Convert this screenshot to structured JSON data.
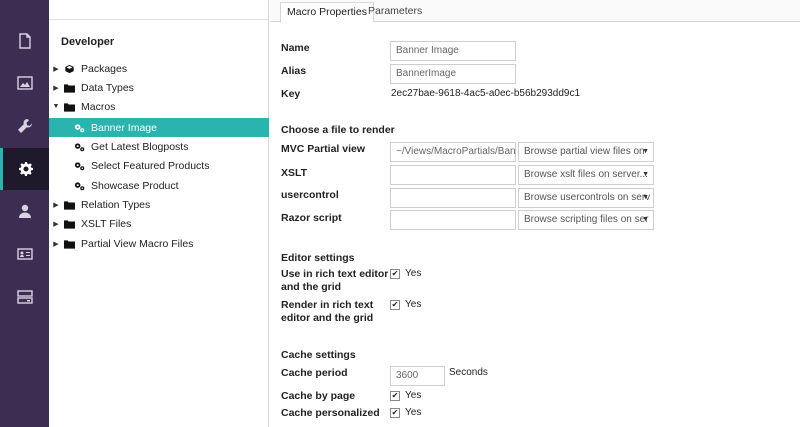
{
  "tabs": [
    {
      "label": "Macro Properties"
    },
    {
      "label": "Parameters"
    }
  ],
  "tree": {
    "section": "Developer",
    "nodes": [
      {
        "label": "Packages",
        "icon": "box-icon"
      },
      {
        "label": "Data Types",
        "icon": "folder-icon"
      },
      {
        "label": "Macros",
        "icon": "folder-icon"
      },
      {
        "label": "Banner Image",
        "icon": "cogs-icon"
      },
      {
        "label": "Get Latest Blogposts",
        "icon": "cogs-icon"
      },
      {
        "label": "Select Featured Products",
        "icon": "cogs-icon"
      },
      {
        "label": "Showcase Product",
        "icon": "cogs-icon"
      },
      {
        "label": "Relation Types",
        "icon": "folder-icon"
      },
      {
        "label": "XSLT Files",
        "icon": "folder-icon"
      },
      {
        "label": "Partial View Macro Files",
        "icon": "folder-icon"
      }
    ]
  },
  "props": {
    "name_label": "Name",
    "name_value": "Banner Image",
    "alias_label": "Alias",
    "alias_value": "BannerImage",
    "key_label": "Key",
    "key_value": "2ec27bae-9618-4ac5-a0ec-b56b293dd9c1",
    "choose_file_heading": "Choose a file to render",
    "mvc_label": "MVC Partial view",
    "mvc_value": "~/Views/MacroPartials/Bann",
    "mvc_browse": "Browse partial view files on",
    "xslt_label": "XSLT",
    "xslt_value": "",
    "xslt_browse": "Browse xslt files on server...",
    "usercontrol_label": "usercontrol",
    "usercontrol_value": "",
    "usercontrol_browse": "Browse usercontrols on serv",
    "razor_label": "Razor script",
    "razor_value": "",
    "razor_browse": "Browse scripting files on ser",
    "editor_heading": "Editor settings",
    "rte_label_1": "Use in rich text editor",
    "rte_label_2": "and the grid",
    "rte_yes": "Yes",
    "render_label_1": "Render in rich text",
    "render_label_2": "editor and the grid",
    "render_yes": "Yes",
    "cache_heading": "Cache settings",
    "cache_period_label": "Cache period",
    "cache_period_value": "3600",
    "cache_period_unit": "Seconds",
    "cache_by_page_label": "Cache by page",
    "cache_by_page_yes": "Yes",
    "cache_personalized_label": "Cache personalized",
    "cache_personalized_yes": "Yes"
  },
  "colors": {
    "rail": "#3d2d52",
    "accent": "#2bb3ad"
  }
}
